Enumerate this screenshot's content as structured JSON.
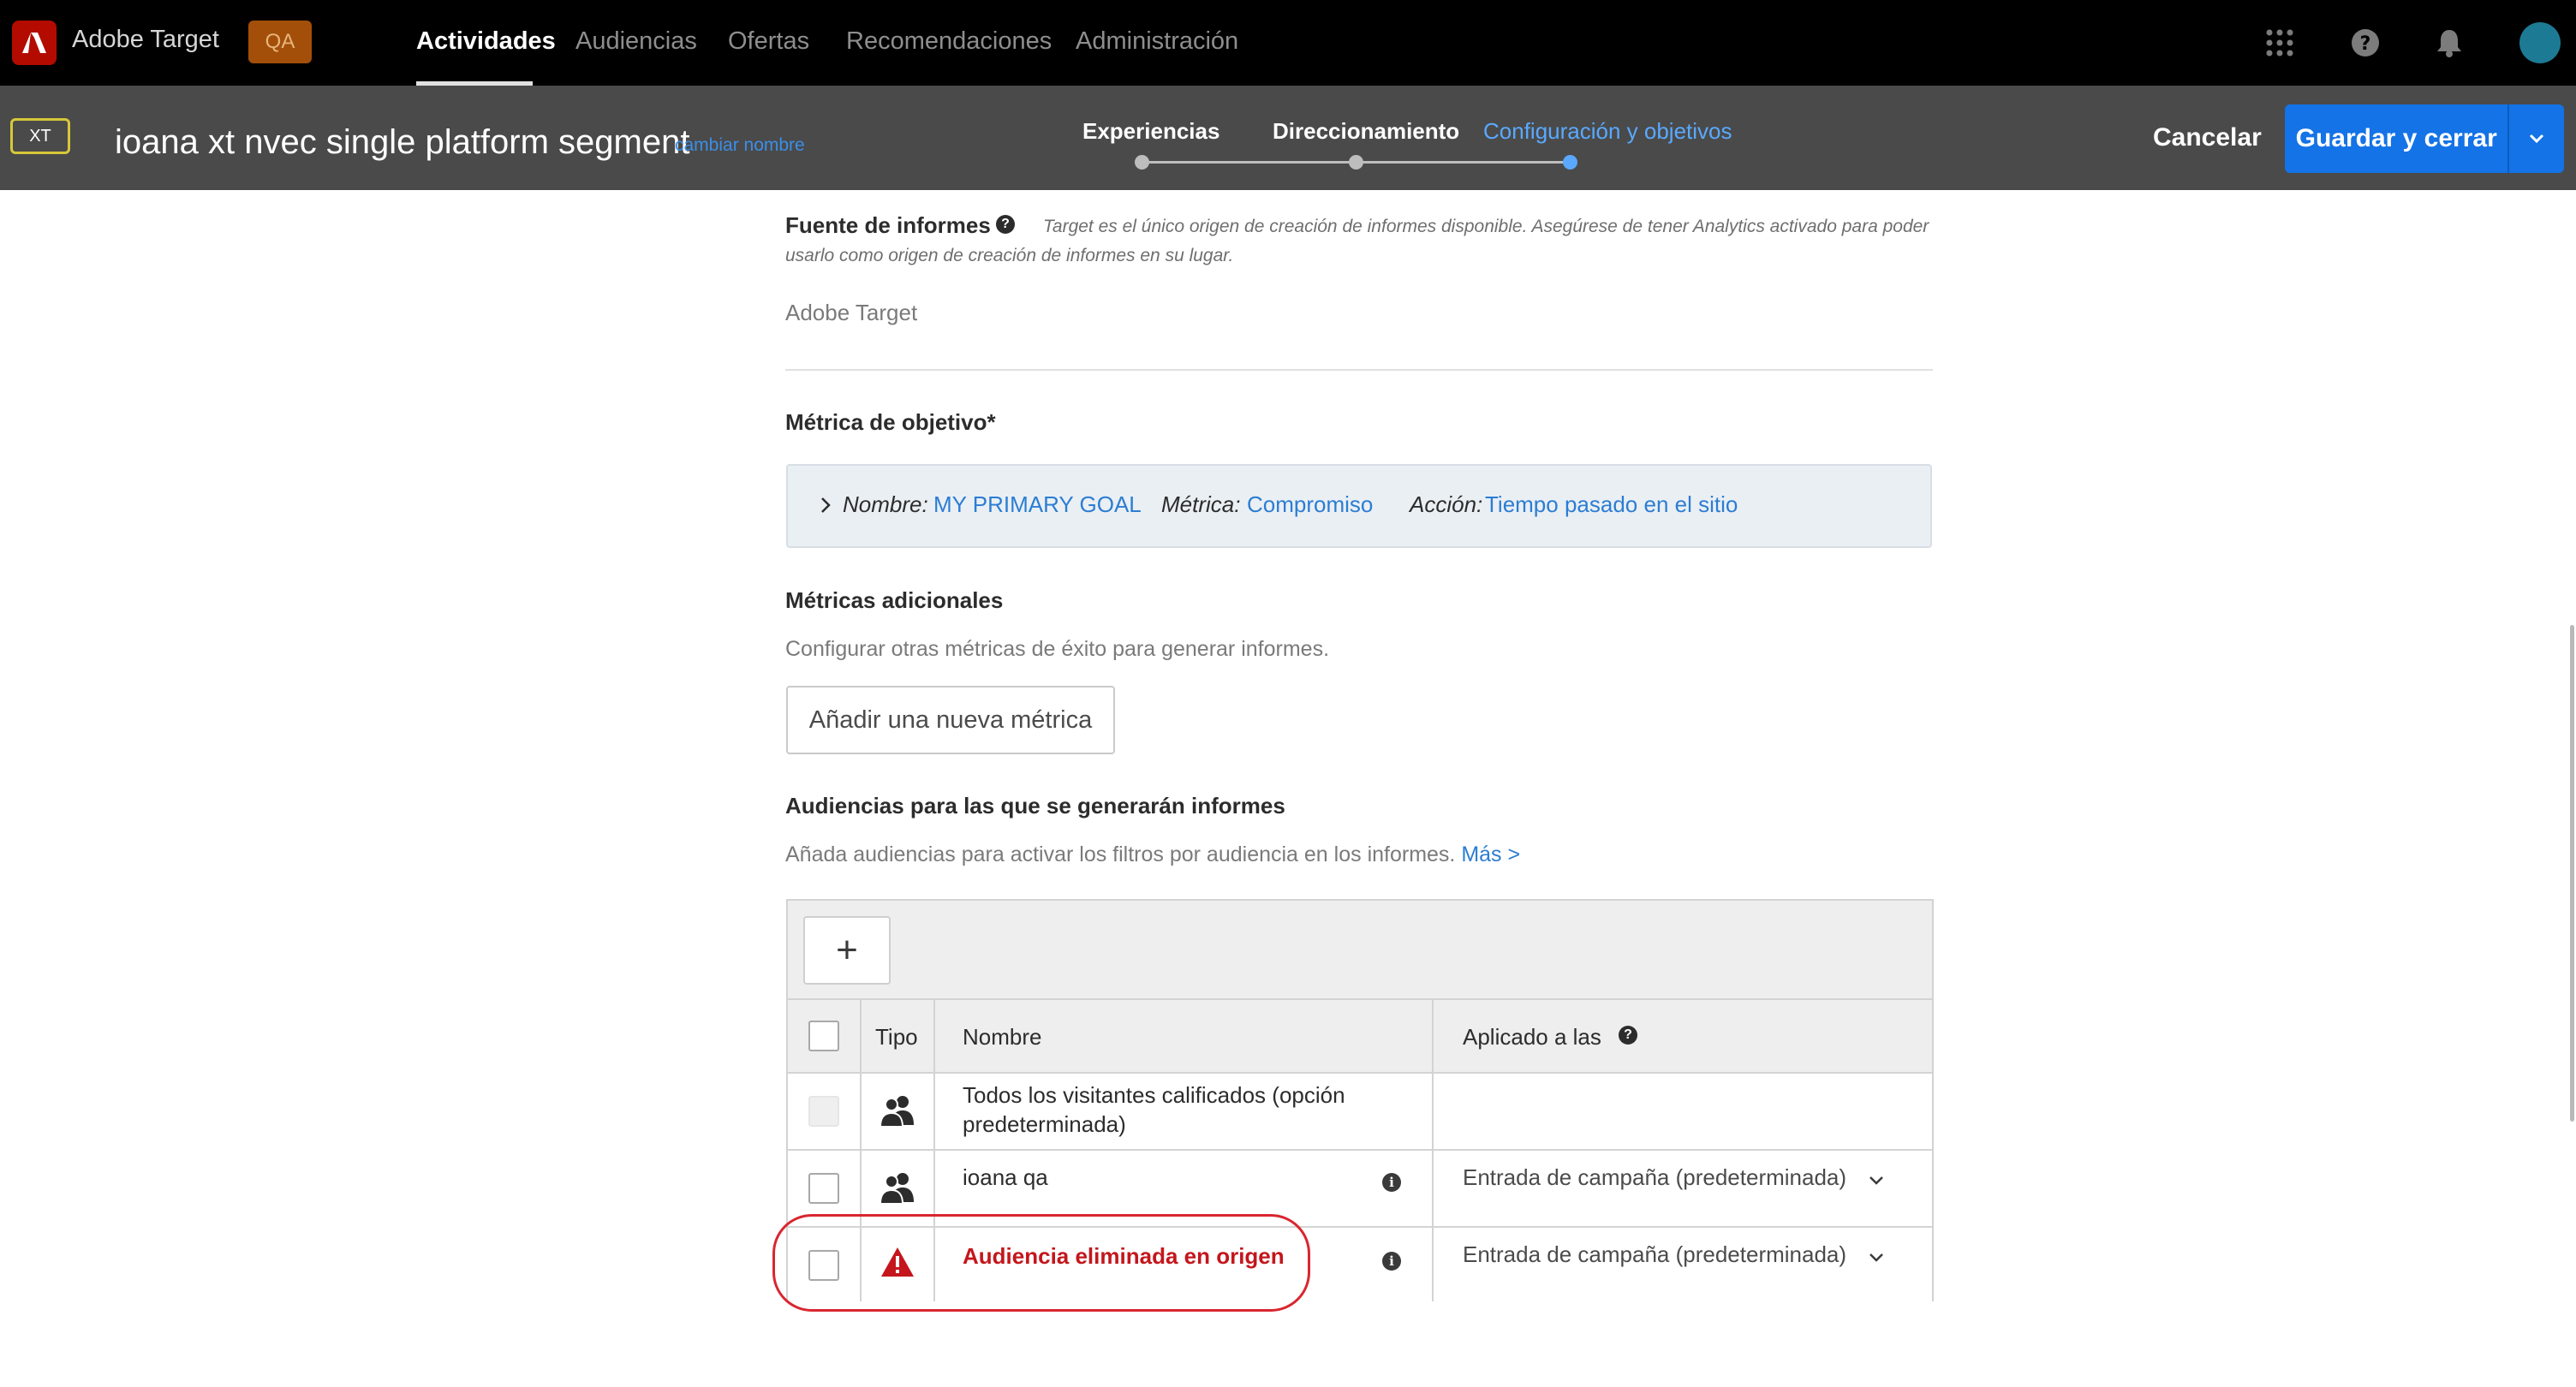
{
  "topnav": {
    "app_title": "Adobe Target",
    "env_badge": "QA",
    "tabs": [
      {
        "label": "Actividades",
        "active": true
      },
      {
        "label": "Audiencias",
        "active": false
      },
      {
        "label": "Ofertas",
        "active": false
      },
      {
        "label": "Recomendaciones",
        "active": false
      },
      {
        "label": "Administración",
        "active": false
      }
    ],
    "icons": [
      "apps-grid-icon",
      "help-icon",
      "bell-icon",
      "avatar"
    ]
  },
  "activity_header": {
    "type_badge": "XT",
    "name": "ioana xt nvec single platform segment",
    "rename_link": "cambiar nombre",
    "steps": [
      {
        "label": "Experiencias",
        "current": false
      },
      {
        "label": "Direccionamiento",
        "current": false
      },
      {
        "label": "Configuración y objetivos",
        "current": true
      }
    ],
    "cancel_label": "Cancelar",
    "save_label": "Guardar y cerrar"
  },
  "reporting_source": {
    "title": "Fuente de informes",
    "note_line1": "Target es el único origen de creación de informes disponible. Asegúrese de tener Analytics activado para poder",
    "note_line2": "usarlo como origen de creación de informes en su lugar.",
    "value": "Adobe Target"
  },
  "goal_metric": {
    "title": "Métrica de objetivo*",
    "name_key": "Nombre:",
    "name_value": "MY PRIMARY GOAL",
    "metric_key": "Métrica:",
    "metric_value": "Compromiso",
    "action_key": "Acción:",
    "action_value": "Tiempo pasado en el sitio"
  },
  "additional_metrics": {
    "title": "Métricas adicionales",
    "description": "Configurar otras métricas de éxito para generar informes.",
    "add_button": "Añadir una nueva métrica"
  },
  "audiences": {
    "title": "Audiencias para las que se generarán informes",
    "description": "Añada audiencias para activar los filtros por audiencia en los informes.",
    "more_link": "Más >",
    "add_button": "+",
    "columns": {
      "type": "Tipo",
      "name": "Nombre",
      "applied": "Aplicado a las"
    },
    "rows": [
      {
        "type_icon": "users-icon",
        "name_line1": "Todos los visitantes calificados (opción",
        "name_line2": "predeterminada)",
        "applied": "",
        "disabled": true
      },
      {
        "type_icon": "users-icon",
        "name_line1": "ioana qa",
        "name_line2": "",
        "applied": "Entrada de campaña (predeterminada)",
        "disabled": false
      },
      {
        "type_icon": "warning-icon",
        "name_line1": "Audiencia eliminada en origen",
        "name_line2": "",
        "applied": "Entrada de campaña (predeterminada)",
        "disabled": false,
        "warning": true
      }
    ]
  },
  "colors": {
    "accent": "#1473e6",
    "link": "#2c7dd2",
    "warning": "#c4161c",
    "highlight_ring": "#d9262f"
  }
}
